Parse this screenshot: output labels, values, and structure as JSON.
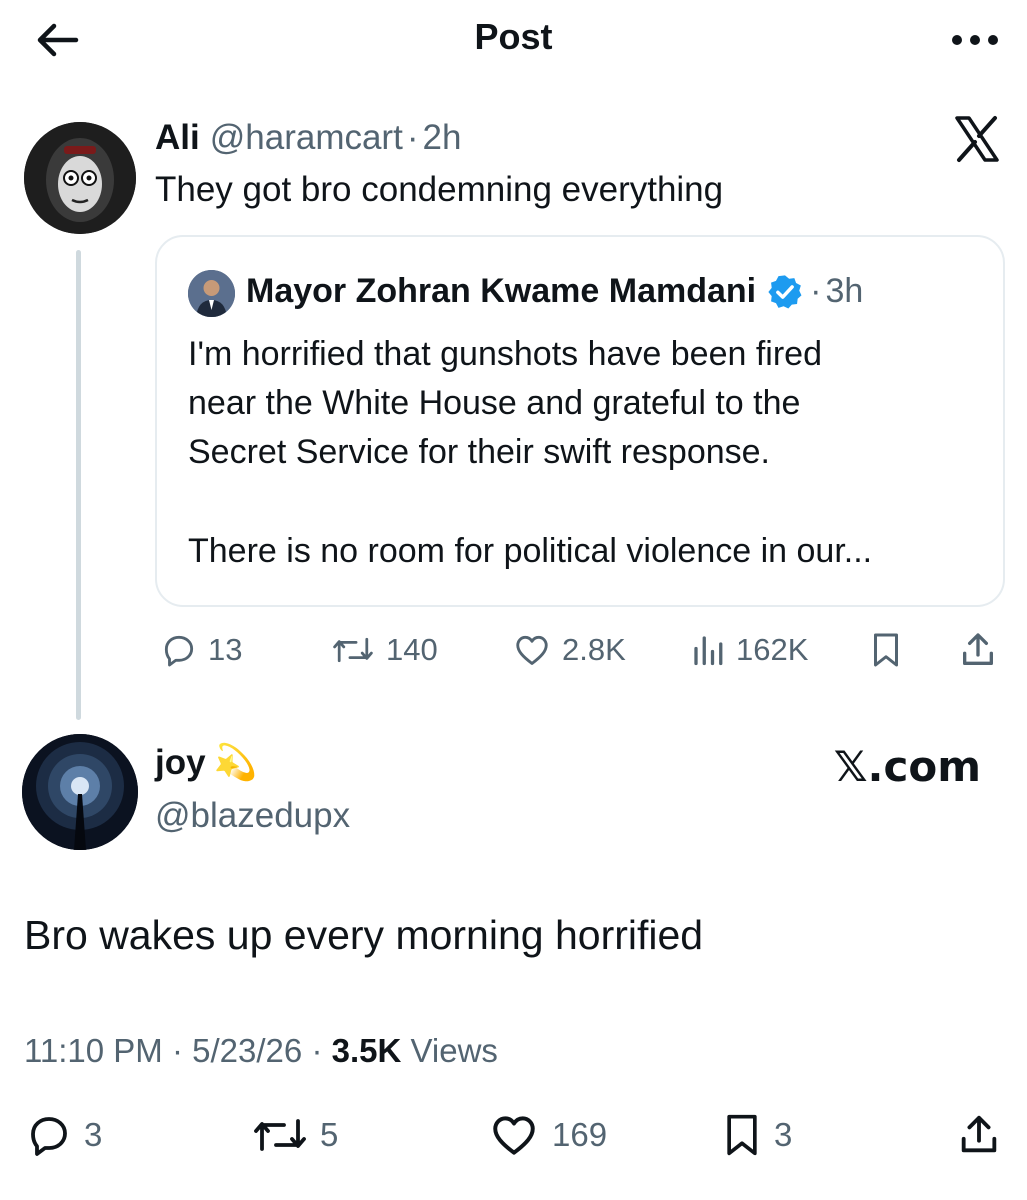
{
  "header": {
    "title": "Post",
    "back_icon": "arrow-left-icon",
    "more_icon": "more-horizontal-icon"
  },
  "parent": {
    "name": "Ali",
    "handle": "@haramcart",
    "separator": "·",
    "time": "2h",
    "text": "They got bro condemning everything",
    "platform_icon": "x-logo-icon",
    "quote": {
      "name": "Mayor Zohran Kwame Mamdani",
      "verified_icon": "verified-badge-icon",
      "separator": "·",
      "time": "3h",
      "text_lines": [
        "I'm horrified that gunshots have been fired",
        "near the White House and grateful to the",
        "Secret Service for their swift response.",
        "There is no room for political violence in our..."
      ]
    },
    "actions": {
      "replies": "13",
      "reposts": "140",
      "likes": "2.8K",
      "views": "162K"
    }
  },
  "reply": {
    "name": "joy",
    "name_emoji": "💫",
    "handle": "@blazedupx",
    "watermark": "𝕏.com",
    "text": "Bro wakes up every morning horrified",
    "time": "11:10 PM",
    "sep": "·",
    "date": "5/23/26",
    "views_count": "3.5K",
    "views_label": "Views",
    "actions": {
      "replies": "3",
      "reposts": "5",
      "likes": "169",
      "bookmarks": "3"
    }
  },
  "colors": {
    "text": "#0f1419",
    "secondary": "#536471",
    "verified": "#1d9bf0",
    "border": "#e6ecf0"
  }
}
